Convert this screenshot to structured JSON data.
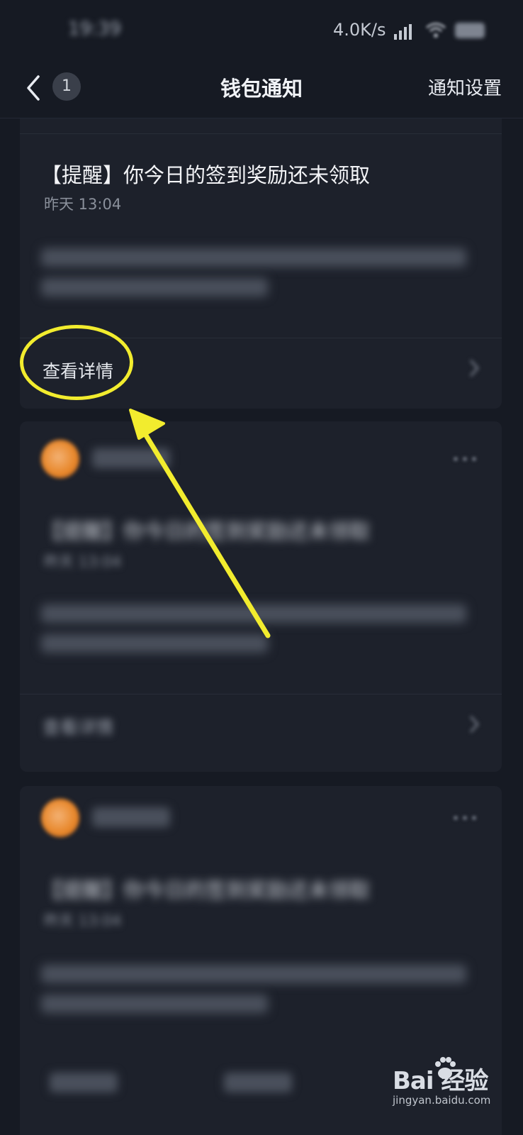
{
  "status_bar": {
    "time": "19:39",
    "network_speed": "4.0K/s"
  },
  "nav": {
    "badge_count": "1",
    "title": "钱包通知",
    "settings_label": "通知设置"
  },
  "notifications": [
    {
      "title": "【提醒】你今日的签到奖励还未领取",
      "time": "昨天 13:04",
      "action_label": "查看详情"
    },
    {
      "title": "【提醒】你今日的签到奖励还未领取",
      "time": "昨天 13:04",
      "action_label": "查看详情"
    },
    {
      "title": "【提醒】你今日的签到奖励还未领取",
      "time": "昨天 13:04"
    }
  ],
  "watermark": {
    "brand": "Bai  经验",
    "url": "jingyan.baidu.com"
  },
  "colors": {
    "background": "#161a23",
    "card": "#1d212b",
    "highlight": "#f2ec2e",
    "avatar": "#e8882c"
  }
}
